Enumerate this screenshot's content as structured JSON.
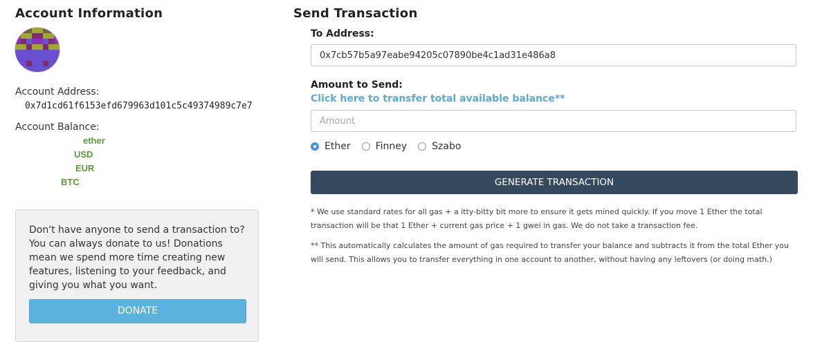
{
  "account": {
    "title": "Account Information",
    "address_label": "Account Address:",
    "address_value": "0x7d1cd61f6153efd679963d101c5c49374989c7e7",
    "balance_label": "Account Balance:",
    "balances": [
      {
        "currency": "ether"
      },
      {
        "currency": "USD"
      },
      {
        "currency": "EUR"
      },
      {
        "currency": "BTC"
      }
    ]
  },
  "donate": {
    "text": "Don't have anyone to send a transaction to? You can always donate to us! Donations mean we spend more time creating new features, listening to your feedback, and giving you what you want.",
    "button_label": "DONATE"
  },
  "send": {
    "title": "Send Transaction",
    "to_label": "To Address:",
    "to_value": "0x7cb57b5a97eabe94205c07890be4c1ad31e486a8",
    "amount_label": "Amount to Send:",
    "transfer_all_link": "Click here to transfer total available balance**",
    "amount_placeholder": "Amount",
    "units": [
      {
        "label": "Ether",
        "checked": true
      },
      {
        "label": "Finney",
        "checked": false
      },
      {
        "label": "Szabo",
        "checked": false
      }
    ],
    "generate_label": "GENERATE TRANSACTION",
    "note1": "* We use standard rates for all gas + a itty-bitty bit more to ensure it gets mined quickly. If you move 1 Ether the total transaction will be that 1 Ether + current gas price + 1 gwei in gas. We do not take a transaction fee.",
    "note2": "** This automatically calculates the amount of gas required to transfer your balance and subtracts it from the total Ether you will send. This allows you to transfer everything in one account to another, without having any leftovers (or doing math.)"
  },
  "colors": {
    "primary_button": "#34495e",
    "donate_button": "#5bb3dd",
    "link": "#5fa8d3",
    "balance_text": "#5a9a3a"
  }
}
